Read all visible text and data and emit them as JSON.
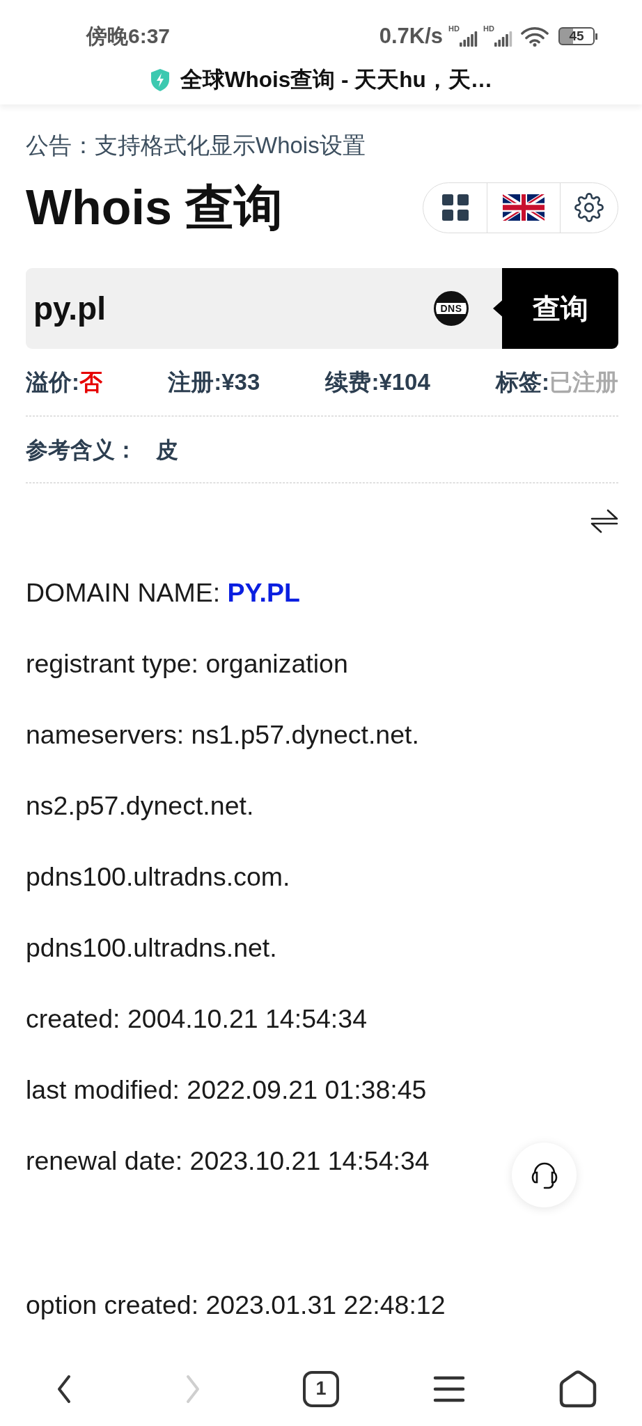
{
  "status_bar": {
    "time": "傍晚6:37",
    "network_speed": "0.7K/s",
    "signal_badges": [
      "HD",
      "HD"
    ],
    "battery": "45"
  },
  "browser_bar": {
    "title": "全球Whois查询 - 天天hu，天…"
  },
  "announcement": "公告：支持格式化显示Whois设置",
  "heading": "Whois 查询",
  "search": {
    "value": "py.pl",
    "dns_label": "DNS",
    "button": "查询"
  },
  "price_info": [
    {
      "label": "溢价:",
      "value": "否",
      "color": "#e60000"
    },
    {
      "label": "注册:",
      "value": "¥33",
      "color": "#2c3e50"
    },
    {
      "label": "续费:",
      "value": "¥104",
      "color": "#2c3e50"
    },
    {
      "label": "标签:",
      "value": "已注册",
      "color": "#aaaaaa"
    }
  ],
  "reference": {
    "label": "参考含义：",
    "value": "皮"
  },
  "whois_blocks": [
    {
      "lines": [
        {
          "kind": "domain",
          "label": "DOMAIN NAME:",
          "value": "PY.PL"
        },
        {
          "kind": "text",
          "text": "registrant type: organization"
        },
        {
          "kind": "text",
          "text": "nameservers: ns1.p57.dynect.net."
        },
        {
          "kind": "text",
          "text": "ns2.p57.dynect.net."
        },
        {
          "kind": "text",
          "text": "pdns100.ultradns.com."
        },
        {
          "kind": "text",
          "text": "pdns100.ultradns.net."
        },
        {
          "kind": "text",
          "text": "created: 2004.10.21 14:54:34"
        },
        {
          "kind": "text",
          "text": "last modified: 2022.09.21 01:38:45"
        },
        {
          "kind": "text",
          "text": "renewal date: 2023.10.21 14:54:34"
        }
      ]
    },
    {
      "lines": [
        {
          "kind": "text",
          "text": "option created: 2023.01.31 22:48:12"
        }
      ]
    }
  ],
  "bottom_nav": [
    {
      "kind": "back",
      "disabled": false
    },
    {
      "kind": "forward",
      "disabled": true
    },
    {
      "kind": "tabs",
      "count": "1",
      "disabled": false
    },
    {
      "kind": "menu",
      "disabled": false
    },
    {
      "kind": "home",
      "disabled": false
    }
  ]
}
